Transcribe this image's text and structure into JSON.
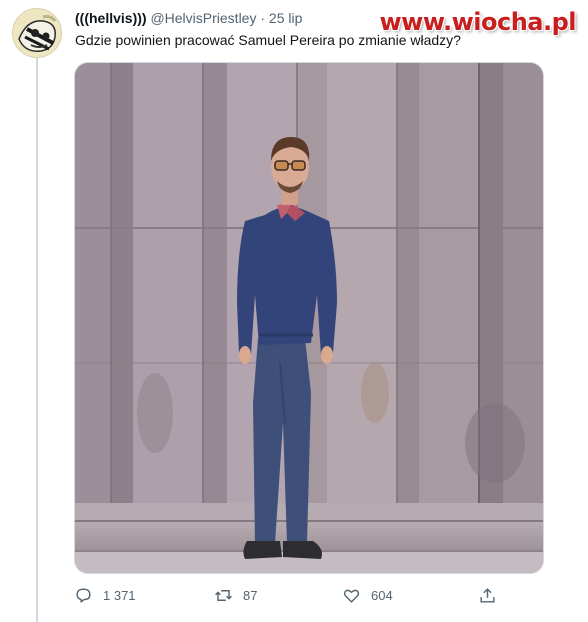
{
  "tweet": {
    "display_name": "(((hellvis)))",
    "handle": "@HelvisPriestley",
    "separator": "·",
    "date": "25 lip",
    "text": "Gdzie powinien pracować Samuel Pereira po zmianie władzy?",
    "avatar_icon": "skull-avatar-icon"
  },
  "watermark": {
    "text": "www.wiocha.pl"
  },
  "actions": {
    "replies": "1 371",
    "retweets": "87",
    "likes": "604"
  },
  "colors": {
    "text": "#0f1419",
    "secondary": "#536471",
    "thread_line": "#cfd9de",
    "watermark": "#c81e1e"
  }
}
